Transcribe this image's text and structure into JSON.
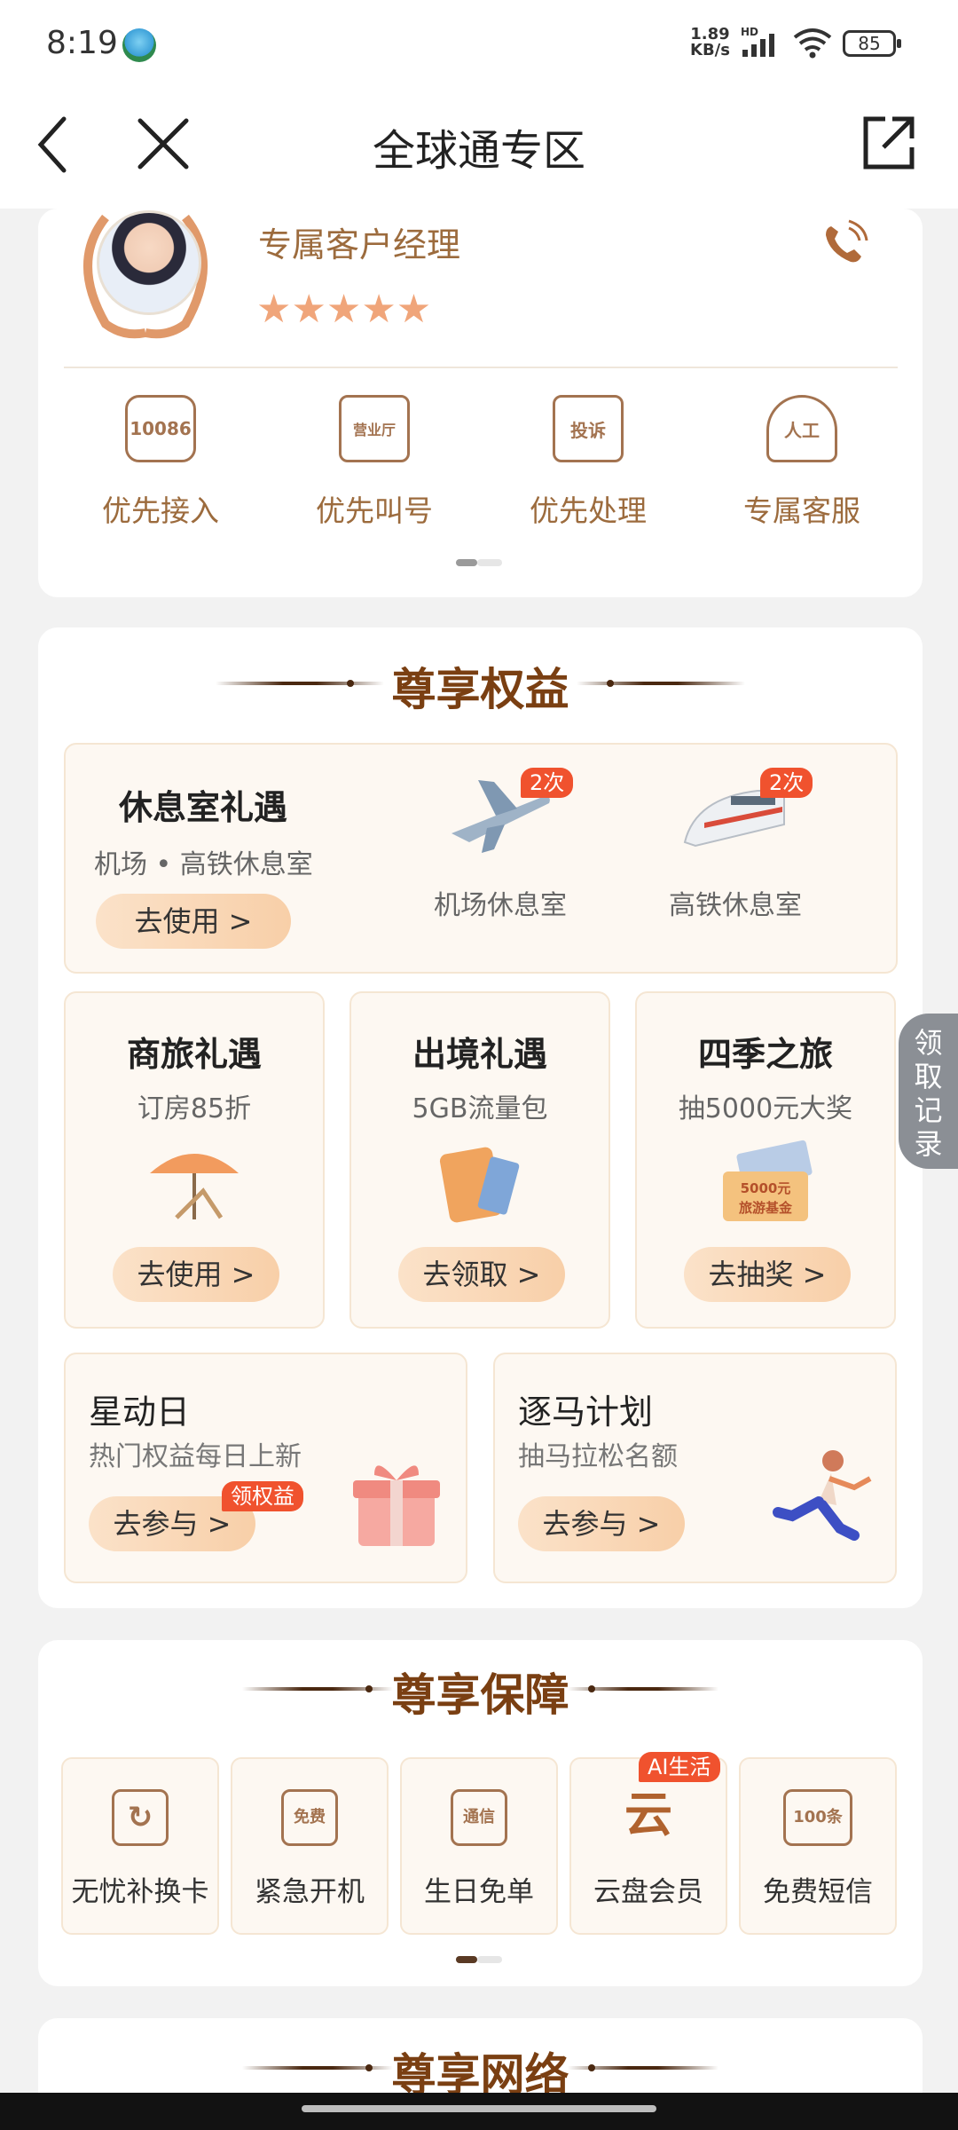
{
  "status_bar": {
    "time": "8:19",
    "net_speed_value": "1.89",
    "net_speed_unit": "KB/s",
    "hd_label": "HD",
    "battery": "85",
    "app_icon": "app-notification-icon",
    "signal_icon": "cellular-signal-icon",
    "wifi_icon": "wifi-icon"
  },
  "nav": {
    "title": "全球通专区",
    "back_icon": "back-arrow-icon",
    "close_icon": "close-icon",
    "share_icon": "share-icon"
  },
  "manager": {
    "name": "专属客户经理",
    "stars": "★★★★★",
    "rating": 5,
    "phone_icon": "phone-icon",
    "services": [
      {
        "label": "优先接入",
        "icon_text": "10086",
        "icon": "chat-bubble-10086-icon"
      },
      {
        "label": "优先叫号",
        "icon_text": "营业厅",
        "icon": "service-hall-icon"
      },
      {
        "label": "优先处理",
        "icon_text": "投诉",
        "icon": "complaint-box-icon"
      },
      {
        "label": "专属客服",
        "icon_text": "人工",
        "icon": "headset-agent-icon"
      }
    ]
  },
  "benefits": {
    "title": "尊享权益",
    "lounge": {
      "title": "休息室礼遇",
      "subtitle": "机场 • 高铁休息室",
      "button": "去使用 >",
      "items": [
        {
          "label": "机场休息室",
          "badge": "2次",
          "icon": "airplane-icon"
        },
        {
          "label": "高铁休息室",
          "badge": "2次",
          "icon": "high-speed-train-icon"
        }
      ]
    },
    "cards": [
      {
        "title": "商旅礼遇",
        "subtitle": "订房85折",
        "button": "去使用 >",
        "icon": "beach-umbrella-chair-icon"
      },
      {
        "title": "出境礼遇",
        "subtitle": "5GB流量包",
        "button": "去领取 >",
        "icon": "passport-ticket-icon"
      },
      {
        "title": "四季之旅",
        "subtitle": "抽5000元大奖",
        "button": "去抽奖 >",
        "icon": "travel-fund-ticket-icon",
        "ticket_text_1": "5000元",
        "ticket_text_2": "旅游基金"
      }
    ],
    "wide_cards": [
      {
        "title": "星动日",
        "subtitle": "热门权益每日上新",
        "button": "去参与 >",
        "badge": "领权益",
        "icon": "gift-box-icon"
      },
      {
        "title": "逐马计划",
        "subtitle": "抽马拉松名额",
        "button": "去参与 >",
        "icon": "runner-icon"
      }
    ]
  },
  "side_button": {
    "label": "领取记录"
  },
  "guarantee": {
    "title": "尊享保障",
    "items": [
      {
        "label": "无忧补换卡",
        "icon_text": "↻",
        "icon": "sim-card-swap-icon"
      },
      {
        "label": "紧急开机",
        "icon_text": "免费",
        "icon": "emergency-phone-icon"
      },
      {
        "label": "生日免单",
        "icon_text": "通信",
        "icon": "birthday-cake-icon"
      },
      {
        "label": "云盘会员",
        "icon_text": "云",
        "icon": "cloud-drive-icon",
        "badge": "AI生活"
      },
      {
        "label": "免费短信",
        "icon_text": "100条",
        "icon": "envelope-sms-icon"
      }
    ]
  },
  "network": {
    "title": "尊享网络"
  }
}
